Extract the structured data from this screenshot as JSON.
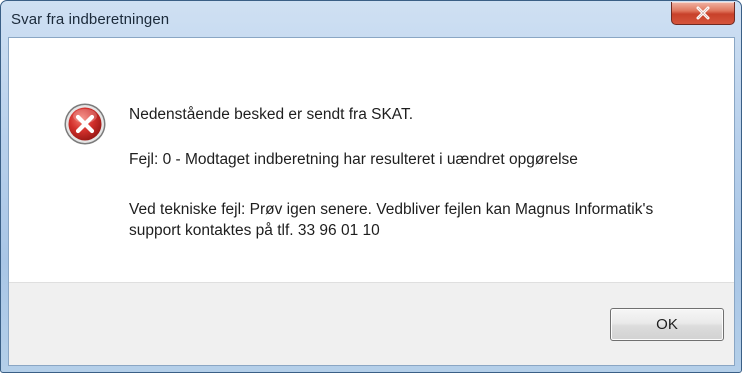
{
  "window": {
    "title": "Svar fra indberetningen"
  },
  "message": {
    "icon": "error-icon",
    "line1": "Nedenstående besked er sendt fra SKAT.",
    "line2": "Fejl: 0 - Modtaget indberetning har resulteret i uændret opgørelse",
    "line3": "Ved tekniske fejl: Prøv igen senere. Vedbliver fejlen kan Magnus Informatik's support kontaktes på tlf. 33 96 01 10"
  },
  "buttons": {
    "ok_label": "OK"
  },
  "colors": {
    "accent_error": "#c8282a",
    "titlebar": "#b9d1ec",
    "footer": "#f0f0f0"
  }
}
